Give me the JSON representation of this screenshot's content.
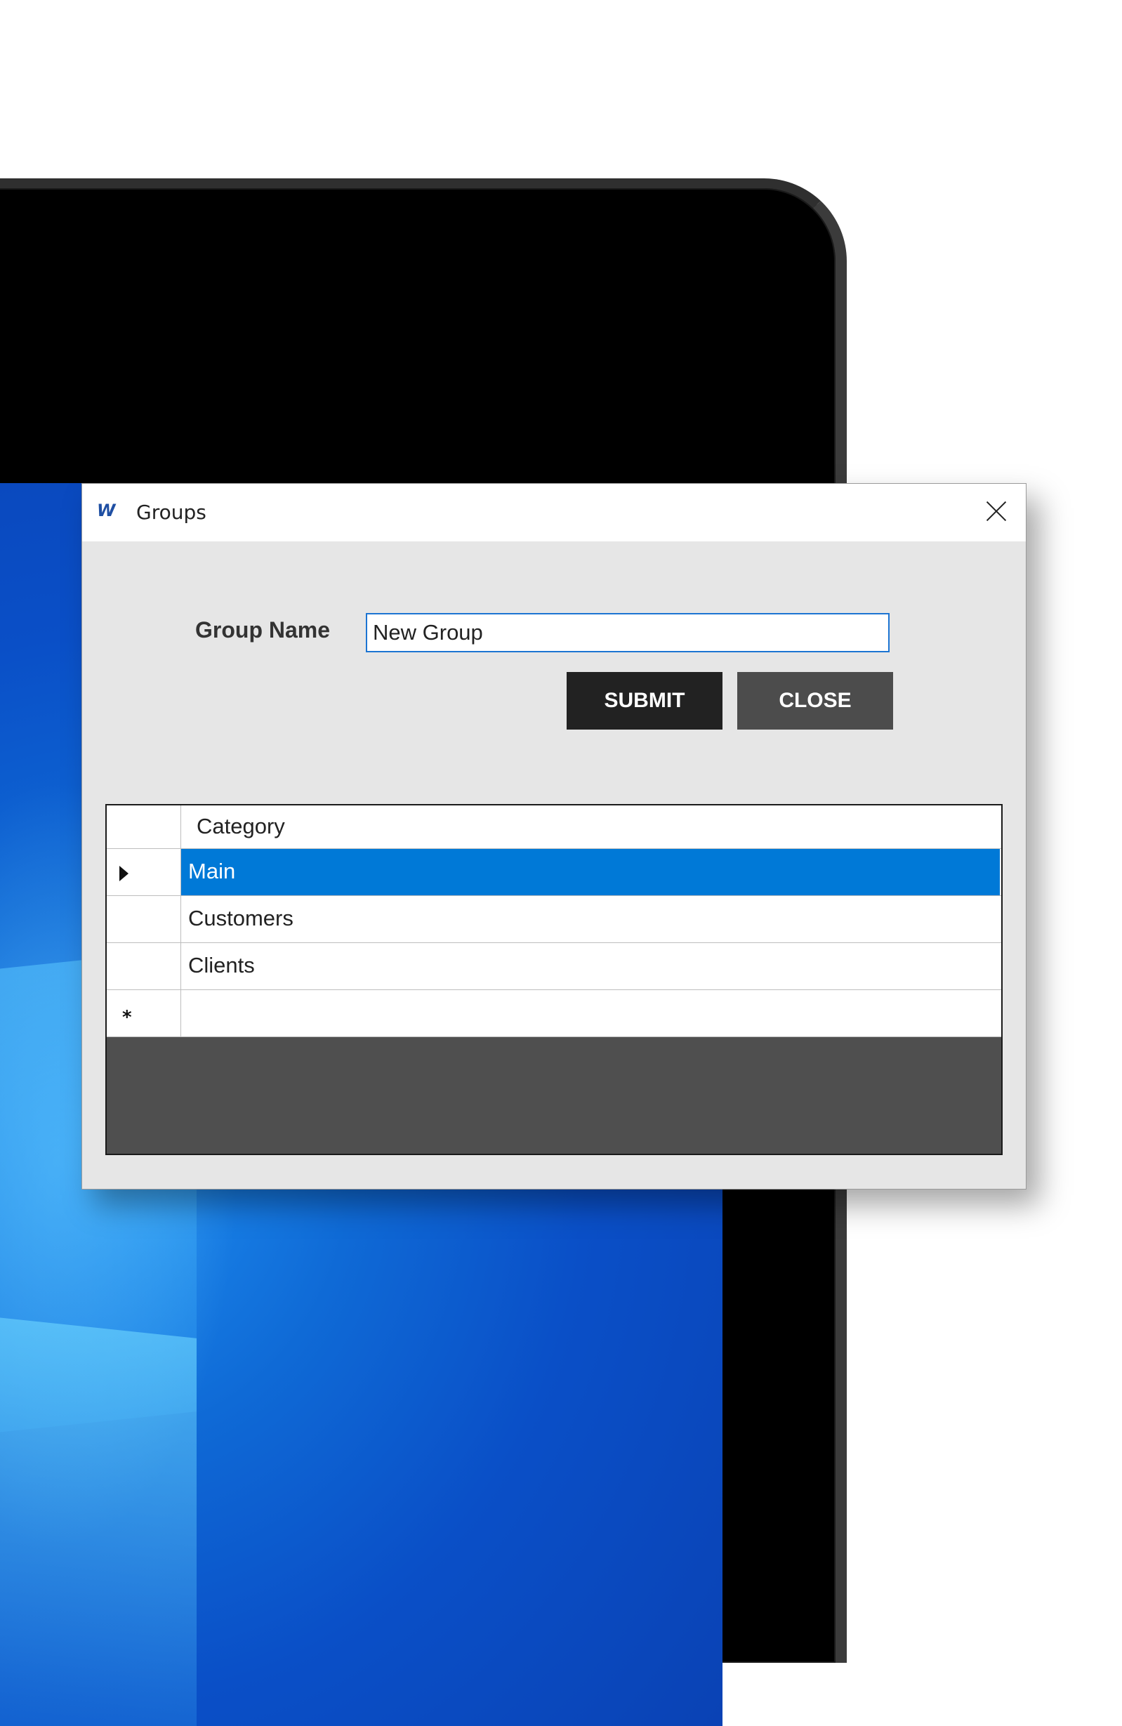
{
  "window": {
    "app_logo": "W",
    "title": "Groups"
  },
  "form": {
    "group_name_label": "Group Name",
    "group_name_value": "New Group",
    "submit_label": "SUBMIT",
    "close_label": "CLOSE"
  },
  "grid": {
    "column_header": "Category",
    "rows": [
      {
        "category": "Main",
        "selected": true
      },
      {
        "category": "Customers",
        "selected": false
      },
      {
        "category": "Clients",
        "selected": false
      }
    ],
    "new_row_marker": "*"
  },
  "colors": {
    "accent": "#0079d7",
    "input_border": "#1c74d2",
    "submit_bg": "#222222",
    "close_bg": "#4c4c4c",
    "grid_background": "#4f4f4f"
  }
}
